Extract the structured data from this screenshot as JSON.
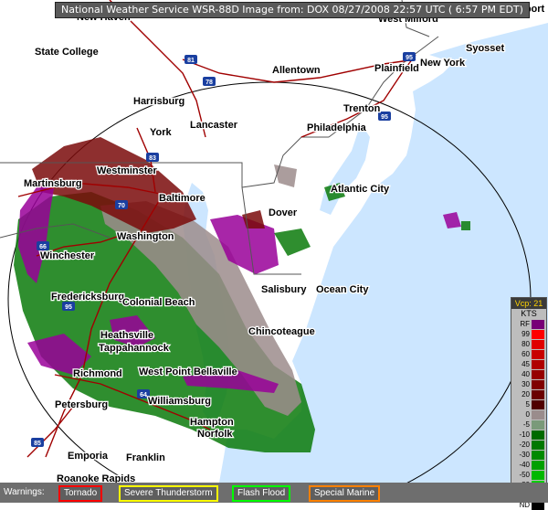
{
  "header": {
    "title": "National Weather Service WSR-88D Image from: DOX 08/27/2008 22:57 UTC ( 6:57 PM EDT)"
  },
  "cities": [
    {
      "name": "State College"
    },
    {
      "name": "Allentown"
    },
    {
      "name": "Harrisburg"
    },
    {
      "name": "Lancaster"
    },
    {
      "name": "York"
    },
    {
      "name": "Trenton"
    },
    {
      "name": "Philadelphia"
    },
    {
      "name": "Westminster"
    },
    {
      "name": "Martinsburg"
    },
    {
      "name": "Baltimore"
    },
    {
      "name": "Dover"
    },
    {
      "name": "Atlantic City"
    },
    {
      "name": "Washington"
    },
    {
      "name": "Winchester"
    },
    {
      "name": "Fredericksburg"
    },
    {
      "name": "Colonial Beach"
    },
    {
      "name": "Salisbury"
    },
    {
      "name": "Ocean City"
    },
    {
      "name": "Chincoteague"
    },
    {
      "name": "Heathsville"
    },
    {
      "name": "Tappahannock"
    },
    {
      "name": "Richmond"
    },
    {
      "name": "West Point"
    },
    {
      "name": "Bellaville"
    },
    {
      "name": "Williamsburg"
    },
    {
      "name": "Petersburg"
    },
    {
      "name": "Hampton"
    },
    {
      "name": "Norfolk"
    },
    {
      "name": "Emporia"
    },
    {
      "name": "Franklin"
    },
    {
      "name": "Roanoke Rapids"
    },
    {
      "name": "Plainfield"
    },
    {
      "name": "New York"
    },
    {
      "name": "Syosset"
    },
    {
      "name": "West Milford"
    },
    {
      "name": "Bridgeport"
    },
    {
      "name": "New Haven"
    }
  ],
  "highways": [
    "81",
    "78",
    "83",
    "70",
    "66",
    "95",
    "64",
    "85",
    "95",
    "95"
  ],
  "legend": {
    "header": "Vcp: 21",
    "unit": "KTS",
    "items": [
      {
        "label": "RF",
        "color": "#770077"
      },
      {
        "label": "99",
        "color": "#ff0000"
      },
      {
        "label": "80",
        "color": "#e00000"
      },
      {
        "label": "60",
        "color": "#c80000"
      },
      {
        "label": "45",
        "color": "#b00000"
      },
      {
        "label": "40",
        "color": "#960000"
      },
      {
        "label": "30",
        "color": "#800000"
      },
      {
        "label": "20",
        "color": "#6a0000"
      },
      {
        "label": "5",
        "color": "#500000"
      },
      {
        "label": "0",
        "color": "#9a8c8c"
      },
      {
        "label": "-5",
        "color": "#7a9a7a"
      },
      {
        "label": "-10",
        "color": "#006a00"
      },
      {
        "label": "-20",
        "color": "#007800"
      },
      {
        "label": "-30",
        "color": "#008a00"
      },
      {
        "label": "-40",
        "color": "#00a000"
      },
      {
        "label": "-50",
        "color": "#00b800"
      },
      {
        "label": "-80",
        "color": "#00d000"
      },
      {
        "label": "-99",
        "color": "#00ff00"
      },
      {
        "label": "ND",
        "color": "#000000"
      }
    ]
  },
  "warnings": {
    "label": "Warnings:",
    "items": [
      {
        "label": "Tornado",
        "color": "#ff0000"
      },
      {
        "label": "Severe Thunderstorm",
        "color": "#ffff00"
      },
      {
        "label": "Flash Flood",
        "color": "#00ff00"
      },
      {
        "label": "Special Marine",
        "color": "#ff8000"
      }
    ]
  },
  "colors": {
    "water": "#cce6ff",
    "land": "#ffffff",
    "velocity_inbound": "#0a7a0a",
    "velocity_outbound": "#7a0a0a",
    "range_folded": "#990099",
    "near_zero": "#9c8c8c"
  }
}
